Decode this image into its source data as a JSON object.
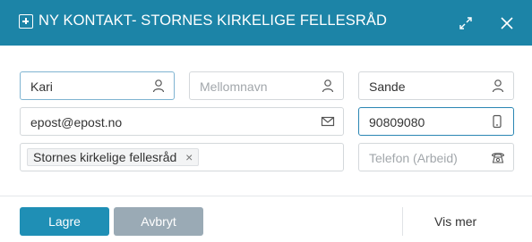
{
  "dialog": {
    "title": "NY KONTAKT- STORNES KIRKELIGE FELLESRÅD",
    "icons": {
      "title_icon": "plus-square-icon",
      "expand": "expand-icon",
      "close": "close-icon"
    }
  },
  "form": {
    "first_name": {
      "value": "Kari",
      "icon": "person-icon"
    },
    "middle_name": {
      "placeholder": "Mellomnavn",
      "icon": "person-icon"
    },
    "last_name": {
      "value": "Sande",
      "icon": "person-icon"
    },
    "email": {
      "value": "epost@epost.no",
      "icon": "envelope-icon"
    },
    "mobile": {
      "value": "90809080",
      "icon": "mobile-phone-icon"
    },
    "organization": {
      "tag": "Stornes kirkelige fellesråd",
      "remove": "×"
    },
    "work_phone": {
      "placeholder": "Telefon (Arbeid)",
      "icon": "telephone-icon"
    }
  },
  "footer": {
    "save_label": "Lagre",
    "cancel_label": "Avbryt",
    "more_label": "Vis mer"
  },
  "colors": {
    "header": "#1c84a7",
    "save": "#1f8fb5",
    "cancel": "#9aaab5",
    "active_border": "#2a86b3"
  }
}
